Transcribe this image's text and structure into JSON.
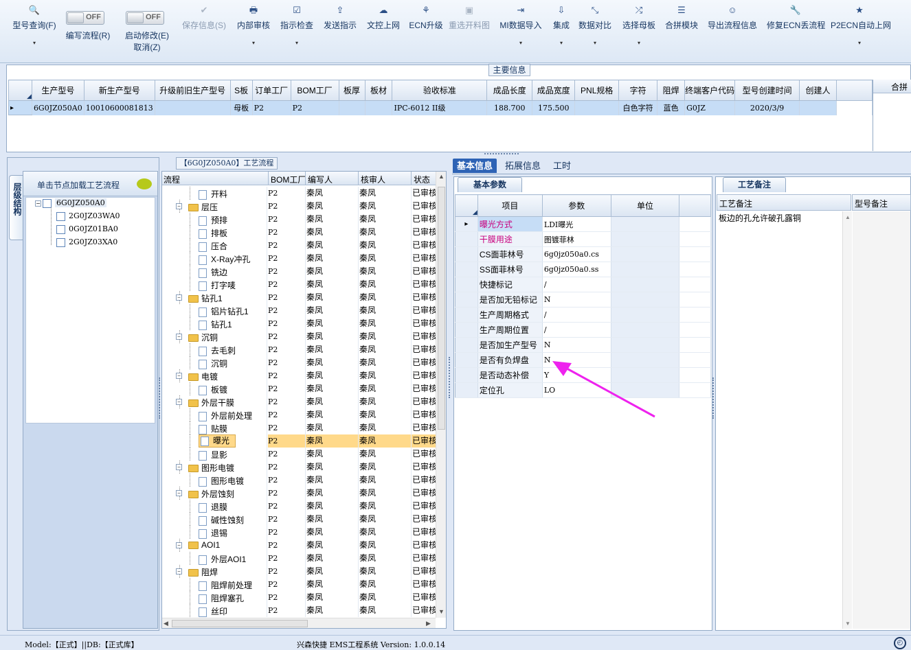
{
  "toolbar": {
    "items": [
      {
        "label": "型号查询(F)",
        "icon": "🔍"
      },
      {
        "label": "编写流程(R)"
      },
      {
        "label": "启动修改(E)",
        "sub": "取消(Z)"
      },
      {
        "label": "保存信息(S)",
        "icon": "✔"
      },
      {
        "label": "内部审核",
        "icon": "🖶"
      },
      {
        "label": "指示检查",
        "icon": "☑"
      },
      {
        "label": "发送指示",
        "icon": "⇪"
      },
      {
        "label": "文控上网",
        "icon": "☁"
      },
      {
        "label": "ECN升级",
        "icon": "⚘"
      },
      {
        "label": "重选开料图",
        "icon": "▣"
      },
      {
        "label": "MI数据导入",
        "icon": "⇥"
      },
      {
        "label": "集成",
        "icon": "⇩"
      },
      {
        "label": "数据对比",
        "icon": "⤡"
      },
      {
        "label": "选择母板",
        "icon": "⤮"
      },
      {
        "label": "合拼模块",
        "icon": "☰"
      },
      {
        "label": "导出流程信息",
        "icon": "☺"
      },
      {
        "label": "修复ECN丢流程",
        "icon": "🔧"
      },
      {
        "label": "P2ECN自动上网",
        "icon": "★"
      }
    ],
    "off": "OFF"
  },
  "main_info": {
    "title": "主要信息",
    "columns": [
      "生产型号",
      "新生产型号",
      "升级前旧生产型号",
      "S板",
      "订单工厂",
      "BOM工厂",
      "板厚",
      "板材",
      "验收标准",
      "成品长度",
      "成品宽度",
      "PNL规格",
      "字符",
      "阻焊",
      "终端客户代码",
      "型号创建时间",
      "创建人"
    ],
    "row": [
      "6G0JZ050A0",
      "10010600081813",
      "",
      "母板",
      "P2",
      "P2",
      "",
      "",
      "IPC-6012 II级",
      "188.700",
      "175.500",
      "",
      "白色字符",
      "蓝色",
      "G0JZ",
      "2020/3/9",
      ""
    ],
    "side_header": "合拼"
  },
  "left_panel": {
    "side_tab": "层级结构",
    "header": "单击节点加载工艺流程",
    "root": "6G0JZ050A0",
    "children": [
      "2G0JZ03WA0",
      "0G0JZ01BA0",
      "2G0JZ03XA0"
    ]
  },
  "process": {
    "title": "【6G0JZ050A0】工艺流程",
    "columns": [
      "流程",
      "BOM工厂",
      "编写人",
      "核审人",
      "状态"
    ],
    "rows": [
      {
        "name": "开料",
        "level": 1,
        "folder": false
      },
      {
        "name": "层压",
        "level": 0,
        "folder": true
      },
      {
        "name": "预排",
        "level": 1,
        "folder": false
      },
      {
        "name": "排板",
        "level": 1,
        "folder": false
      },
      {
        "name": "压合",
        "level": 1,
        "folder": false
      },
      {
        "name": "X-Ray冲孔",
        "level": 1,
        "folder": false
      },
      {
        "name": "铣边",
        "level": 1,
        "folder": false
      },
      {
        "name": "打字唛",
        "level": 1,
        "folder": false
      },
      {
        "name": "钻孔1",
        "level": 0,
        "folder": true
      },
      {
        "name": "铝片钻孔1",
        "level": 1,
        "folder": false
      },
      {
        "name": "钻孔1",
        "level": 1,
        "folder": false
      },
      {
        "name": "沉铜",
        "level": 0,
        "folder": true
      },
      {
        "name": "去毛刺",
        "level": 1,
        "folder": false
      },
      {
        "name": "沉铜",
        "level": 1,
        "folder": false
      },
      {
        "name": "电镀",
        "level": 0,
        "folder": true
      },
      {
        "name": "板镀",
        "level": 1,
        "folder": false
      },
      {
        "name": "外层干膜",
        "level": 0,
        "folder": true
      },
      {
        "name": "外层前处理",
        "level": 1,
        "folder": false
      },
      {
        "name": "贴膜",
        "level": 1,
        "folder": false
      },
      {
        "name": "曝光",
        "level": 1,
        "folder": false,
        "selected": true
      },
      {
        "name": "显影",
        "level": 1,
        "folder": false
      },
      {
        "name": "图形电镀",
        "level": 0,
        "folder": true
      },
      {
        "name": "图形电镀",
        "level": 1,
        "folder": false
      },
      {
        "name": "外层蚀刻",
        "level": 0,
        "folder": true
      },
      {
        "name": "退膜",
        "level": 1,
        "folder": false
      },
      {
        "name": "碱性蚀刻",
        "level": 1,
        "folder": false
      },
      {
        "name": "退锡",
        "level": 1,
        "folder": false
      },
      {
        "name": "AOI1",
        "level": 0,
        "folder": true
      },
      {
        "name": "外层AOI1",
        "level": 1,
        "folder": false
      },
      {
        "name": "阻焊",
        "level": 0,
        "folder": true
      },
      {
        "name": "阻焊前处理",
        "level": 1,
        "folder": false
      },
      {
        "name": "阻焊塞孔",
        "level": 1,
        "folder": false
      },
      {
        "name": "丝印",
        "level": 1,
        "folder": false
      }
    ],
    "bom": "P2",
    "writer": "秦凤",
    "reviewer": "秦凤",
    "status": "已审核"
  },
  "tabs": [
    "基本信息",
    "拓展信息",
    "工时"
  ],
  "basic_params": {
    "title": "基本参数",
    "columns": [
      "项目",
      "参数",
      "单位"
    ],
    "rows": [
      {
        "item": "曝光方式",
        "value": "LDI曝光",
        "highlight": true
      },
      {
        "item": "干膜用途",
        "value": "图镀菲林",
        "highlight": true
      },
      {
        "item": "CS面菲林号",
        "value": "6g0jz050a0.cs"
      },
      {
        "item": "SS面菲林号",
        "value": "6g0jz050a0.ss"
      },
      {
        "item": "快捷标记",
        "value": "/"
      },
      {
        "item": "是否加无铅标记",
        "value": "N"
      },
      {
        "item": "生产周期格式",
        "value": "/"
      },
      {
        "item": "生产周期位置",
        "value": "/"
      },
      {
        "item": "是否加生产型号",
        "value": "N"
      },
      {
        "item": "是否有负焊盘",
        "value": "N"
      },
      {
        "item": "是否动态补偿",
        "value": "Y"
      },
      {
        "item": "定位孔",
        "value": "LO"
      }
    ]
  },
  "notes": {
    "title": "工艺备注",
    "col1": "工艺备注",
    "col2": "型号备注",
    "text": "板边的孔允许破孔露铜"
  },
  "status": {
    "left": "Model:【正式】||DB:【正式库】",
    "center": "兴森快捷 EMS工程系统 Version: 1.0.0.14"
  },
  "colors": {
    "accent": "#2e63b5",
    "highlight_text": "#c8007e",
    "arrow": "#ee22ee",
    "selected_row": "#ffd98a"
  }
}
